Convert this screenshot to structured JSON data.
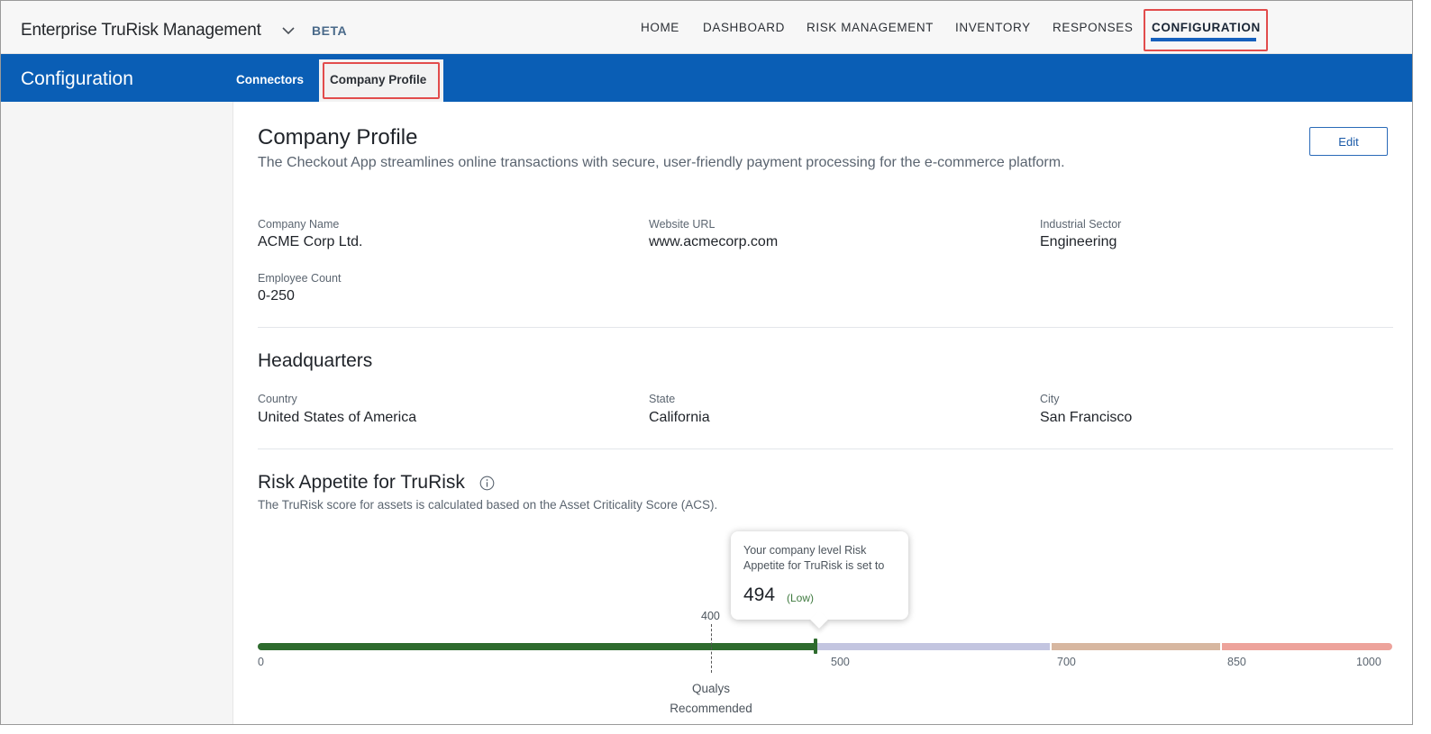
{
  "app": {
    "title": "Enterprise TruRisk Management",
    "badge": "BETA"
  },
  "nav": {
    "items": [
      {
        "label": "HOME"
      },
      {
        "label": "DASHBOARD"
      },
      {
        "label": "RISK MANAGEMENT"
      },
      {
        "label": "INVENTORY"
      },
      {
        "label": "RESPONSES"
      },
      {
        "label": "CONFIGURATION",
        "active": true
      }
    ]
  },
  "subheader": {
    "title": "Configuration",
    "tabs": [
      {
        "label": "Connectors"
      },
      {
        "label": "Company Profile",
        "active": true
      }
    ]
  },
  "profile": {
    "title": "Company Profile",
    "description": "The Checkout App streamlines online transactions with secure, user-friendly payment processing for the e-commerce platform.",
    "edit_label": "Edit",
    "fields": {
      "company_name": {
        "label": "Company Name",
        "value": "ACME Corp Ltd."
      },
      "website_url": {
        "label": "Website URL",
        "value": "www.acmecorp.com"
      },
      "industrial_sector": {
        "label": "Industrial Sector",
        "value": "Engineering"
      },
      "employee_count": {
        "label": "Employee Count",
        "value": "0-250"
      }
    }
  },
  "headquarters": {
    "title": "Headquarters",
    "country": {
      "label": "Country",
      "value": "United States of America"
    },
    "state": {
      "label": "State",
      "value": "California"
    },
    "city": {
      "label": "City",
      "value": "San Francisco"
    }
  },
  "risk_appetite": {
    "title": "Risk Appetite for TruRisk",
    "description": "The TruRisk score for assets is calculated based on the Asset Criticality Score (ACS).",
    "tooltip_text": "Your company level Risk Appetite for TruRisk is set to",
    "value": 494,
    "value_label": "494",
    "level": "(Low)",
    "recommended_value": 400,
    "recommended_value_label": "400",
    "recommended_label": "Qualys Recommended",
    "min": 0,
    "max": 1000,
    "ticks": [
      "0",
      "500",
      "700",
      "850",
      "1000"
    ],
    "colors": {
      "green": "#2e6b2e",
      "purple": "#c3c5e0",
      "tan": "#d7b7a0",
      "pink": "#eda39b"
    }
  },
  "colors": {
    "brand_blue": "#0a5eb5",
    "highlight_red": "#e24c4c"
  }
}
